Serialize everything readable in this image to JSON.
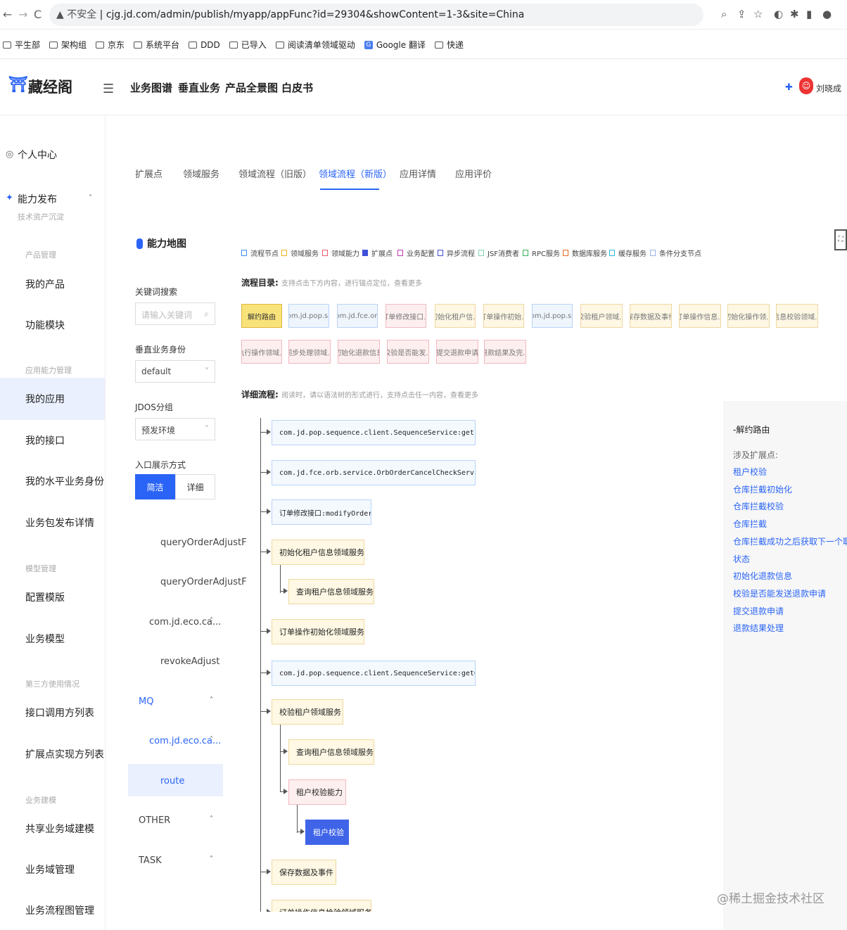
{
  "browser": {
    "nav_back": "←",
    "nav_forward": "→",
    "reload": "C",
    "insecure_label": "▲ 不安全",
    "url": "cjg.jd.com/admin/publish/myapp/appFunc?id=29304&showContent=1-3&site=China"
  },
  "bookmarks": [
    "平生部",
    "架构组",
    "京东",
    "系统平台",
    "DDD",
    "已导入",
    "阅读清单领域驱动",
    "Google 翻译",
    "快递"
  ],
  "header": {
    "app_name": "藏经阁",
    "menu": [
      "业务图谱",
      "垂直业务",
      "产品全景图",
      "白皮书"
    ],
    "user": "刘晓成"
  },
  "sidebar": {
    "personal": "个人中心",
    "publish": "能力发布",
    "publish_sub": "技术资产沉淀",
    "groups": {
      "product": "产品管理",
      "app": "应用能力管理",
      "model": "模型管理",
      "third": "第三方使用情况",
      "modeling": "业务建模"
    },
    "items": {
      "my_product": "我的产品",
      "func_module": "功能模块",
      "my_app": "我的应用",
      "my_api": "我的接口",
      "my_identity": "我的水平业务身份",
      "biz_pkg": "业务包发布详情",
      "config_template": "配置模版",
      "biz_model": "业务模型",
      "api_callers": "接口调用方列表",
      "ext_impl": "扩展点实现方列表",
      "shared_domain": "共享业务域建模",
      "domain_mgmt": "业务域管理",
      "flow_mgmt": "业务流程图管理"
    }
  },
  "tabs": [
    "扩展点",
    "领域服务",
    "领域流程（旧版）",
    "领域流程（新版）",
    "应用详情",
    "应用评价"
  ],
  "left_panel": {
    "title": "能力地图",
    "keyword_label": "关键词搜索",
    "keyword_placeholder": "请输入关键词",
    "identity_label": "垂直业务身份",
    "identity_value": "default",
    "jdos_label": "JDOS分组",
    "jdos_value": "预发环境",
    "entry_label": "入口展示方式",
    "entry_simple": "简洁",
    "entry_detail": "详细",
    "tree": [
      "queryOrderAdjustF",
      "queryOrderAdjustF",
      "com.jd.eco.ca...",
      "revokeAdjust",
      "MQ",
      "com.jd.eco.ca...",
      "route",
      "OTHER",
      "TASK"
    ]
  },
  "legend": [
    {
      "label": "流程节点",
      "color": "#3b8df0"
    },
    {
      "label": "领域服务",
      "color": "#e6b422"
    },
    {
      "label": "领域能力",
      "color": "#e85a71"
    },
    {
      "label": "扩展点",
      "color": "#3f4fd8"
    },
    {
      "label": "业务配置",
      "color": "#c23ab5"
    },
    {
      "label": "异步流程",
      "color": "#3f4fd8"
    },
    {
      "label": "JSF消费者",
      "color": "#7ed6b0"
    },
    {
      "label": "RPC服务",
      "color": "#35b35a"
    },
    {
      "label": "数据库服务",
      "color": "#e66a1f"
    },
    {
      "label": "缓存服务",
      "color": "#2fb7e0"
    },
    {
      "label": "条件分支节点",
      "color": "#9ab2ea"
    }
  ],
  "catalog": {
    "label": "流程目录:",
    "hint": "支持点击下方内容，进行锚点定位，查看更多",
    "items": [
      "解约路由",
      "com.jd.pop.s...",
      "com.jd.fce.or...",
      "订单修改接口...",
      "初始化租户信...",
      "订单操作初始...",
      "com.jd.pop.s...",
      "校验租户领域...",
      "保存数据及事件",
      "订单操作信息...",
      "初始化操作领...",
      "信息校验领域...",
      "执行操作领域...",
      "同步处理领域...",
      "初始化退款信息",
      "校验是否能发...",
      "提交退款申请",
      "退款结果及完..."
    ]
  },
  "detail": {
    "label": "详细流程:",
    "hint": "阅读时，请以语法树的形式进行，支持点击任一内容，查看更多",
    "nodes": [
      "com.jd.pop.sequence.client.SequenceService:getLock...",
      "com.jd.fce.orb.service.OrbOrderCancelCheckService:...",
      "订单修改接口:modifyOrder",
      "初始化租户信息领域服务",
      "查询租户信息领域服务",
      "订单操作初始化领域服务",
      "com.jd.pop.sequence.client.SequenceService:getGlob...",
      "校验租户领域服务",
      "查询租户信息领域服务",
      "租户校验能力",
      "租户校验",
      "保存数据及事件",
      "订单操作信息检验领域服务"
    ]
  },
  "right_panel": {
    "title": "-解约路由",
    "ext_label": "涉及扩展点:",
    "links": [
      "租户校验",
      "仓库拦截初始化",
      "仓库拦截校验",
      "仓库拦截",
      "仓库拦截成功之后获取下一个取消流程",
      "状态",
      "初始化退款信息",
      "校验是否能发送退款申请",
      "提交退款申请",
      "退款结果处理"
    ]
  },
  "watermark": "@稀土掘金技术社区"
}
